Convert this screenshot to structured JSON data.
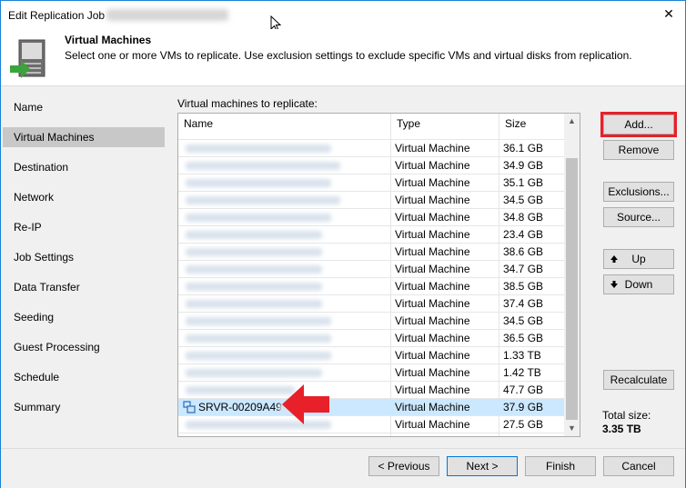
{
  "window": {
    "title": "Edit Replication Job",
    "close_glyph": "✕"
  },
  "header": {
    "title": "Virtual Machines",
    "description": "Select one or more VMs to replicate. Use exclusion settings to exclude specific VMs and virtual disks from replication.",
    "icon": "server-replicate-icon"
  },
  "nav": {
    "items": [
      {
        "label": "Name"
      },
      {
        "label": "Virtual Machines"
      },
      {
        "label": "Destination"
      },
      {
        "label": "Network"
      },
      {
        "label": "Re-IP"
      },
      {
        "label": "Job Settings"
      },
      {
        "label": "Data Transfer"
      },
      {
        "label": "Seeding"
      },
      {
        "label": "Guest Processing"
      },
      {
        "label": "Schedule"
      },
      {
        "label": "Summary"
      }
    ],
    "active": "Virtual Machines"
  },
  "vm_list": {
    "label": "Virtual machines to replicate:",
    "columns": [
      "Name",
      "Type",
      "Size"
    ],
    "rows": [
      {
        "name": "",
        "type": "",
        "size": ""
      },
      {
        "name": "",
        "type": "Virtual Machine",
        "size": "36.1 GB"
      },
      {
        "name": "",
        "type": "Virtual Machine",
        "size": "34.9 GB"
      },
      {
        "name": "",
        "type": "Virtual Machine",
        "size": "35.1 GB"
      },
      {
        "name": "",
        "type": "Virtual Machine",
        "size": "34.5 GB"
      },
      {
        "name": "",
        "type": "Virtual Machine",
        "size": "34.8 GB"
      },
      {
        "name": "",
        "type": "Virtual Machine",
        "size": "23.4 GB"
      },
      {
        "name": "",
        "type": "Virtual Machine",
        "size": "38.6 GB"
      },
      {
        "name": "",
        "type": "Virtual Machine",
        "size": "34.7 GB"
      },
      {
        "name": "",
        "type": "Virtual Machine",
        "size": "38.5 GB"
      },
      {
        "name": "",
        "type": "Virtual Machine",
        "size": "37.4 GB"
      },
      {
        "name": "",
        "type": "Virtual Machine",
        "size": "34.5 GB"
      },
      {
        "name": "",
        "type": "Virtual Machine",
        "size": "36.5 GB"
      },
      {
        "name": "",
        "type": "Virtual Machine",
        "size": "1.33 TB"
      },
      {
        "name": "",
        "type": "Virtual Machine",
        "size": "1.42 TB"
      },
      {
        "name": "",
        "type": "Virtual Machine",
        "size": "47.7 GB"
      },
      {
        "name": "SRVR-00209A49",
        "type": "Virtual Machine",
        "size": "37.9 GB"
      },
      {
        "name": "",
        "type": "Virtual Machine",
        "size": "27.5 GB"
      }
    ],
    "selected_index": 16,
    "selection_color": "#cce8ff"
  },
  "buttons": {
    "add": "Add...",
    "remove": "Remove",
    "exclusions": "Exclusions...",
    "source": "Source...",
    "up": "Up",
    "down": "Down",
    "recalculate": "Recalculate"
  },
  "total": {
    "label": "Total size:",
    "value": "3.35 TB"
  },
  "footer": {
    "previous": "< Previous",
    "next": "Next >",
    "finish": "Finish",
    "cancel": "Cancel"
  },
  "accent": {
    "highlight_red": "#e8202a",
    "selection_blue": "#cce8ff",
    "primary_border": "#0078d7"
  }
}
